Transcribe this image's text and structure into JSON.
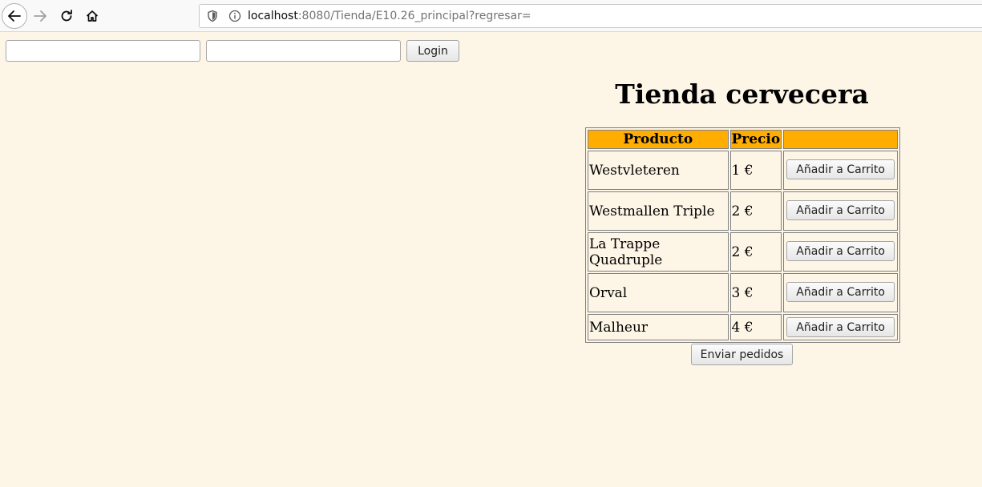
{
  "browser": {
    "url_host": "localhost",
    "url_rest": ":8080/Tienda/E10.26_principal?regresar="
  },
  "login": {
    "user_value": "",
    "pass_value": "",
    "button_label": "Login"
  },
  "store": {
    "title": "Tienda cervecera",
    "headers": [
      "Producto",
      "Precio",
      ""
    ],
    "products": [
      {
        "name": "Westvleteren",
        "price": "1 €",
        "action": "Añadir a Carrito"
      },
      {
        "name": "Westmallen Triple",
        "price": "2 €",
        "action": "Añadir a Carrito"
      },
      {
        "name": "La Trappe Quadruple",
        "price": "2 €",
        "action": "Añadir a Carrito"
      },
      {
        "name": "Orval",
        "price": "3 €",
        "action": "Añadir a Carrito"
      },
      {
        "name": "Malheur",
        "price": "4 €",
        "action": "Añadir a Carrito"
      }
    ],
    "send_label": "Enviar pedidos"
  },
  "colors": {
    "page_background": "#fdf5e6",
    "header_background": "#ffad00"
  }
}
